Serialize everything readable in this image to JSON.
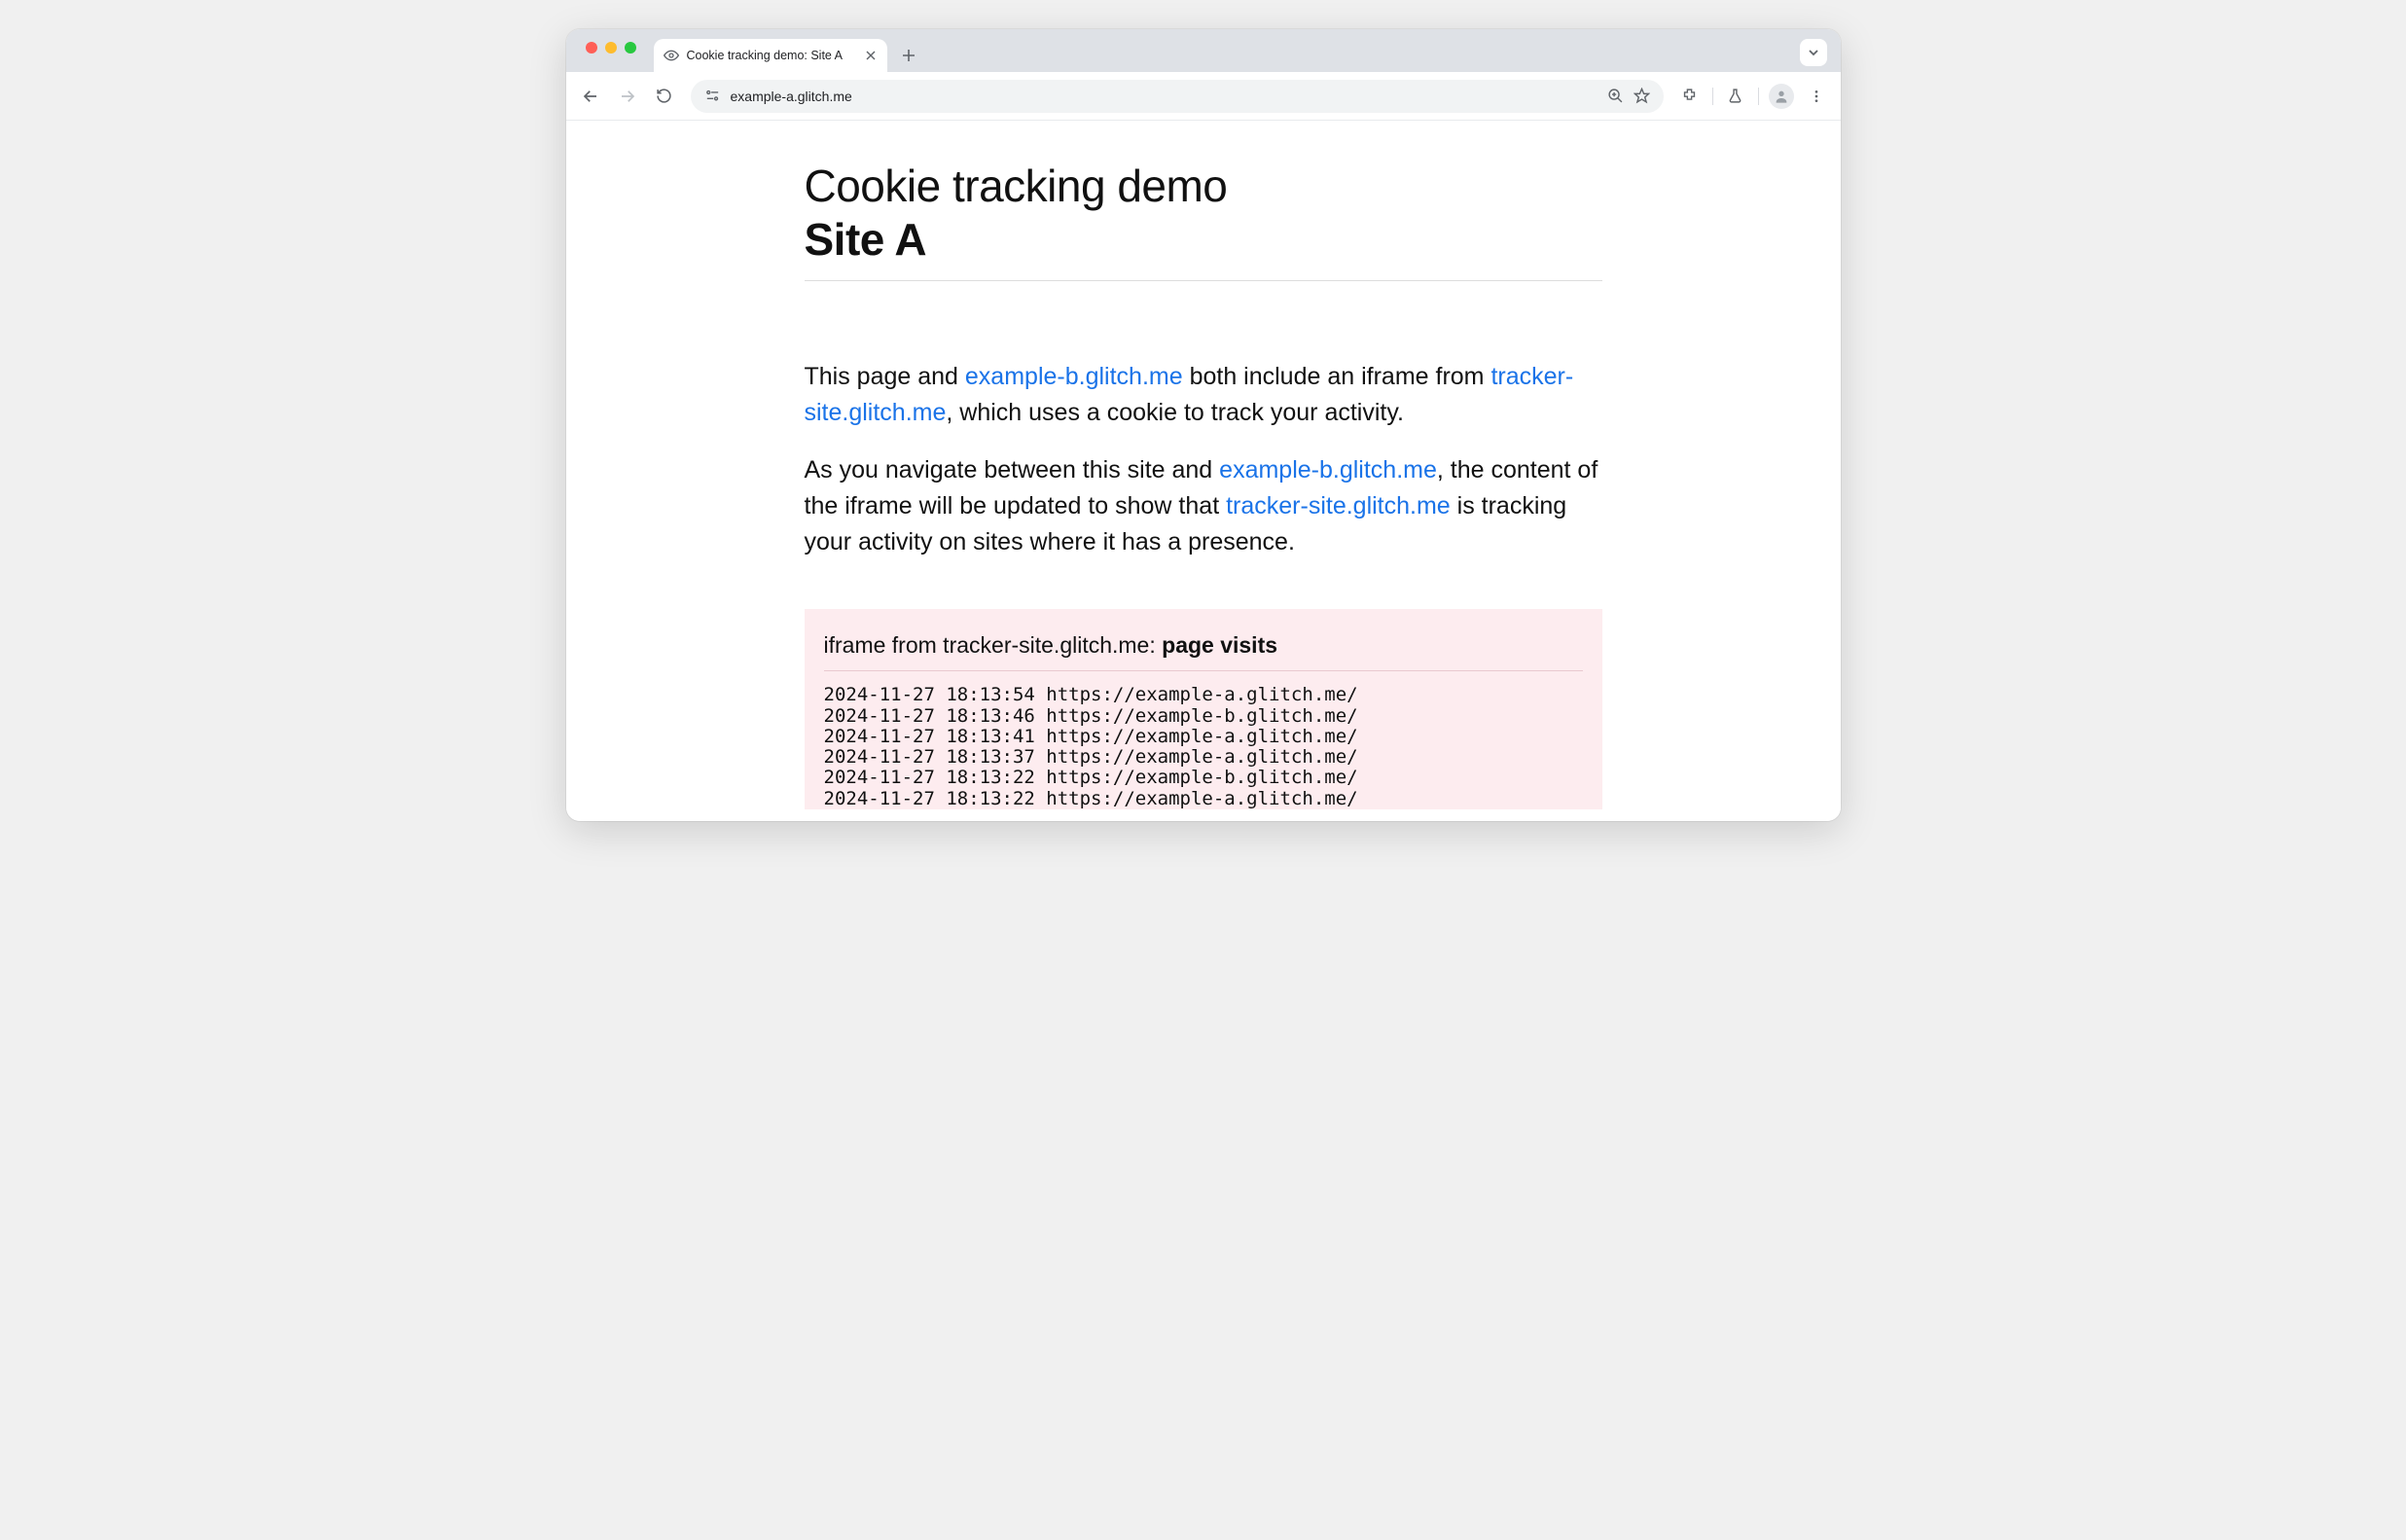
{
  "browser": {
    "tab_title": "Cookie tracking demo: Site A",
    "address": "example-a.glitch.me"
  },
  "page": {
    "title_line1": "Cookie tracking demo",
    "title_line2": "Site A",
    "para1_a": "This page and ",
    "para1_link1": "example-b.glitch.me",
    "para1_b": " both include an iframe from ",
    "para1_link2": "tracker-site.glitch.me",
    "para1_c": ", which uses a cookie to track your activity.",
    "para2_a": "As you navigate between this site and ",
    "para2_link1": "example-b.glitch.me",
    "para2_b": ", the content of the iframe will be updated to show that ",
    "para2_link2": "tracker-site.glitch.me",
    "para2_c": " is tracking your activity on sites where it has a presence."
  },
  "iframe": {
    "heading_prefix": "iframe from tracker-site.glitch.me: ",
    "heading_bold": "page visits",
    "visits": [
      "2024-11-27 18:13:54 https://example-a.glitch.me/",
      "2024-11-27 18:13:46 https://example-b.glitch.me/",
      "2024-11-27 18:13:41 https://example-a.glitch.me/",
      "2024-11-27 18:13:37 https://example-a.glitch.me/",
      "2024-11-27 18:13:22 https://example-b.glitch.me/",
      "2024-11-27 18:13:22 https://example-a.glitch.me/"
    ]
  }
}
